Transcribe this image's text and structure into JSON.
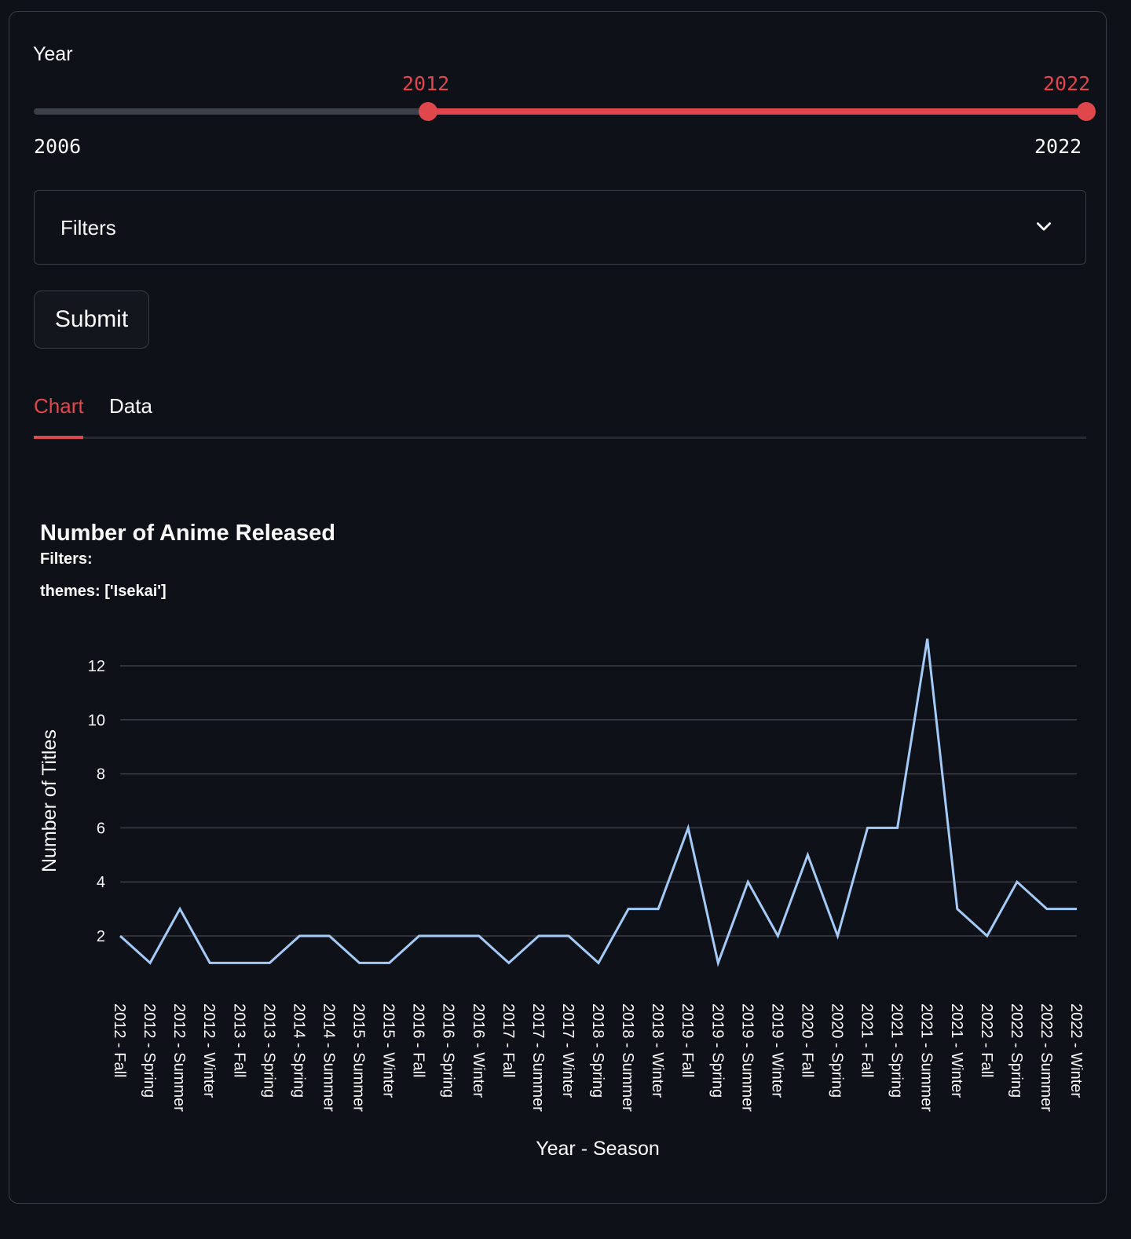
{
  "slider": {
    "label": "Year",
    "min": 2006,
    "max": 2022,
    "value_low": 2012,
    "value_high": 2022,
    "min_label": "2006",
    "max_label": "2022",
    "low_label": "2012",
    "high_label": "2022"
  },
  "expander": {
    "label": "Filters"
  },
  "submit": {
    "label": "Submit"
  },
  "tabs": [
    {
      "label": "Chart",
      "active": true
    },
    {
      "label": "Data",
      "active": false
    }
  ],
  "colors": {
    "accent": "#e0474c",
    "line": "#a4cbf7",
    "background": "#0e1117",
    "grid": "#3a3d45"
  },
  "chart_data": {
    "type": "line",
    "title": "Number of Anime Released",
    "subtitle_lines": [
      "Filters:",
      "themes: ['Isekai']"
    ],
    "xlabel": "Year - Season",
    "ylabel": "Number of Titles",
    "yticks": [
      2,
      4,
      6,
      8,
      10,
      12
    ],
    "ylim": [
      0,
      13
    ],
    "grid": true,
    "categories": [
      "2012 - Fall",
      "2012 - Spring",
      "2012 - Summer",
      "2012 - Winter",
      "2013 - Fall",
      "2013 - Spring",
      "2014 - Spring",
      "2014 - Summer",
      "2015 - Summer",
      "2015 - Winter",
      "2016 - Fall",
      "2016 - Spring",
      "2016 - Winter",
      "2017 - Fall",
      "2017 - Summer",
      "2017 - Winter",
      "2018 - Spring",
      "2018 - Summer",
      "2018 - Winter",
      "2019 - Fall",
      "2019 - Spring",
      "2019 - Summer",
      "2019 - Winter",
      "2020 - Fall",
      "2020 - Spring",
      "2021 - Fall",
      "2021 - Spring",
      "2021 - Summer",
      "2021 - Winter",
      "2022 - Fall",
      "2022 - Spring",
      "2022 - Summer",
      "2022 - Winter"
    ],
    "values": [
      2,
      1,
      3,
      1,
      1,
      1,
      2,
      2,
      1,
      1,
      2,
      2,
      2,
      1,
      2,
      2,
      1,
      3,
      3,
      6,
      1,
      4,
      2,
      5,
      2,
      6,
      6,
      13,
      3,
      2,
      4,
      3,
      3
    ]
  }
}
